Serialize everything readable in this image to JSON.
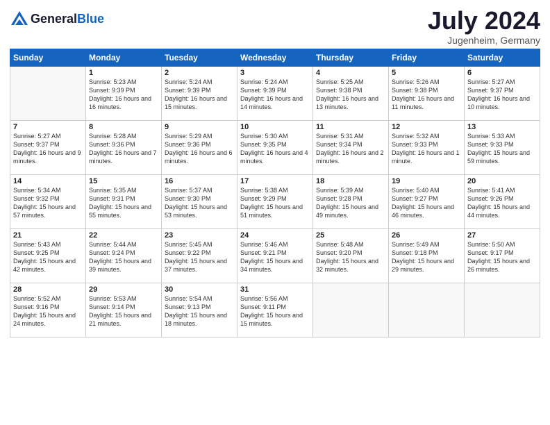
{
  "logo": {
    "general": "General",
    "blue": "Blue"
  },
  "title": "July 2024",
  "location": "Jugenheim, Germany",
  "days_of_week": [
    "Sunday",
    "Monday",
    "Tuesday",
    "Wednesday",
    "Thursday",
    "Friday",
    "Saturday"
  ],
  "weeks": [
    [
      {
        "num": "",
        "sunrise": "",
        "sunset": "",
        "daylight": ""
      },
      {
        "num": "1",
        "sunrise": "Sunrise: 5:23 AM",
        "sunset": "Sunset: 9:39 PM",
        "daylight": "Daylight: 16 hours and 16 minutes."
      },
      {
        "num": "2",
        "sunrise": "Sunrise: 5:24 AM",
        "sunset": "Sunset: 9:39 PM",
        "daylight": "Daylight: 16 hours and 15 minutes."
      },
      {
        "num": "3",
        "sunrise": "Sunrise: 5:24 AM",
        "sunset": "Sunset: 9:39 PM",
        "daylight": "Daylight: 16 hours and 14 minutes."
      },
      {
        "num": "4",
        "sunrise": "Sunrise: 5:25 AM",
        "sunset": "Sunset: 9:38 PM",
        "daylight": "Daylight: 16 hours and 13 minutes."
      },
      {
        "num": "5",
        "sunrise": "Sunrise: 5:26 AM",
        "sunset": "Sunset: 9:38 PM",
        "daylight": "Daylight: 16 hours and 11 minutes."
      },
      {
        "num": "6",
        "sunrise": "Sunrise: 5:27 AM",
        "sunset": "Sunset: 9:37 PM",
        "daylight": "Daylight: 16 hours and 10 minutes."
      }
    ],
    [
      {
        "num": "7",
        "sunrise": "Sunrise: 5:27 AM",
        "sunset": "Sunset: 9:37 PM",
        "daylight": "Daylight: 16 hours and 9 minutes."
      },
      {
        "num": "8",
        "sunrise": "Sunrise: 5:28 AM",
        "sunset": "Sunset: 9:36 PM",
        "daylight": "Daylight: 16 hours and 7 minutes."
      },
      {
        "num": "9",
        "sunrise": "Sunrise: 5:29 AM",
        "sunset": "Sunset: 9:36 PM",
        "daylight": "Daylight: 16 hours and 6 minutes."
      },
      {
        "num": "10",
        "sunrise": "Sunrise: 5:30 AM",
        "sunset": "Sunset: 9:35 PM",
        "daylight": "Daylight: 16 hours and 4 minutes."
      },
      {
        "num": "11",
        "sunrise": "Sunrise: 5:31 AM",
        "sunset": "Sunset: 9:34 PM",
        "daylight": "Daylight: 16 hours and 2 minutes."
      },
      {
        "num": "12",
        "sunrise": "Sunrise: 5:32 AM",
        "sunset": "Sunset: 9:33 PM",
        "daylight": "Daylight: 16 hours and 1 minute."
      },
      {
        "num": "13",
        "sunrise": "Sunrise: 5:33 AM",
        "sunset": "Sunset: 9:33 PM",
        "daylight": "Daylight: 15 hours and 59 minutes."
      }
    ],
    [
      {
        "num": "14",
        "sunrise": "Sunrise: 5:34 AM",
        "sunset": "Sunset: 9:32 PM",
        "daylight": "Daylight: 15 hours and 57 minutes."
      },
      {
        "num": "15",
        "sunrise": "Sunrise: 5:35 AM",
        "sunset": "Sunset: 9:31 PM",
        "daylight": "Daylight: 15 hours and 55 minutes."
      },
      {
        "num": "16",
        "sunrise": "Sunrise: 5:37 AM",
        "sunset": "Sunset: 9:30 PM",
        "daylight": "Daylight: 15 hours and 53 minutes."
      },
      {
        "num": "17",
        "sunrise": "Sunrise: 5:38 AM",
        "sunset": "Sunset: 9:29 PM",
        "daylight": "Daylight: 15 hours and 51 minutes."
      },
      {
        "num": "18",
        "sunrise": "Sunrise: 5:39 AM",
        "sunset": "Sunset: 9:28 PM",
        "daylight": "Daylight: 15 hours and 49 minutes."
      },
      {
        "num": "19",
        "sunrise": "Sunrise: 5:40 AM",
        "sunset": "Sunset: 9:27 PM",
        "daylight": "Daylight: 15 hours and 46 minutes."
      },
      {
        "num": "20",
        "sunrise": "Sunrise: 5:41 AM",
        "sunset": "Sunset: 9:26 PM",
        "daylight": "Daylight: 15 hours and 44 minutes."
      }
    ],
    [
      {
        "num": "21",
        "sunrise": "Sunrise: 5:43 AM",
        "sunset": "Sunset: 9:25 PM",
        "daylight": "Daylight: 15 hours and 42 minutes."
      },
      {
        "num": "22",
        "sunrise": "Sunrise: 5:44 AM",
        "sunset": "Sunset: 9:24 PM",
        "daylight": "Daylight: 15 hours and 39 minutes."
      },
      {
        "num": "23",
        "sunrise": "Sunrise: 5:45 AM",
        "sunset": "Sunset: 9:22 PM",
        "daylight": "Daylight: 15 hours and 37 minutes."
      },
      {
        "num": "24",
        "sunrise": "Sunrise: 5:46 AM",
        "sunset": "Sunset: 9:21 PM",
        "daylight": "Daylight: 15 hours and 34 minutes."
      },
      {
        "num": "25",
        "sunrise": "Sunrise: 5:48 AM",
        "sunset": "Sunset: 9:20 PM",
        "daylight": "Daylight: 15 hours and 32 minutes."
      },
      {
        "num": "26",
        "sunrise": "Sunrise: 5:49 AM",
        "sunset": "Sunset: 9:18 PM",
        "daylight": "Daylight: 15 hours and 29 minutes."
      },
      {
        "num": "27",
        "sunrise": "Sunrise: 5:50 AM",
        "sunset": "Sunset: 9:17 PM",
        "daylight": "Daylight: 15 hours and 26 minutes."
      }
    ],
    [
      {
        "num": "28",
        "sunrise": "Sunrise: 5:52 AM",
        "sunset": "Sunset: 9:16 PM",
        "daylight": "Daylight: 15 hours and 24 minutes."
      },
      {
        "num": "29",
        "sunrise": "Sunrise: 5:53 AM",
        "sunset": "Sunset: 9:14 PM",
        "daylight": "Daylight: 15 hours and 21 minutes."
      },
      {
        "num": "30",
        "sunrise": "Sunrise: 5:54 AM",
        "sunset": "Sunset: 9:13 PM",
        "daylight": "Daylight: 15 hours and 18 minutes."
      },
      {
        "num": "31",
        "sunrise": "Sunrise: 5:56 AM",
        "sunset": "Sunset: 9:11 PM",
        "daylight": "Daylight: 15 hours and 15 minutes."
      },
      {
        "num": "",
        "sunrise": "",
        "sunset": "",
        "daylight": ""
      },
      {
        "num": "",
        "sunrise": "",
        "sunset": "",
        "daylight": ""
      },
      {
        "num": "",
        "sunrise": "",
        "sunset": "",
        "daylight": ""
      }
    ]
  ]
}
